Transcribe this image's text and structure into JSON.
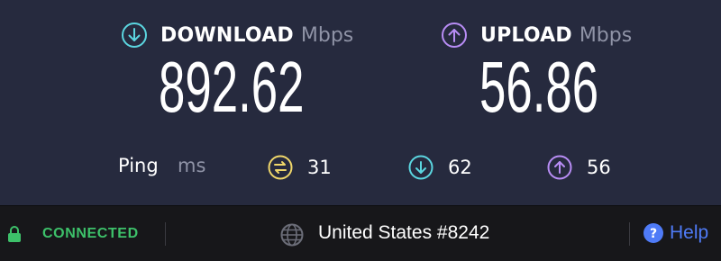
{
  "download": {
    "label": "DOWNLOAD",
    "unit": "Mbps",
    "value": "892.62",
    "icon": "arrow-down-circle-icon",
    "color": "#5bd6e0"
  },
  "upload": {
    "label": "UPLOAD",
    "unit": "Mbps",
    "value": "56.86",
    "icon": "arrow-up-circle-icon",
    "color": "#b88df5"
  },
  "ping": {
    "label": "Ping",
    "unit": "ms",
    "idle": {
      "value": "31",
      "icon": "ping-idle-icon",
      "color": "#f0d76a"
    },
    "download": {
      "value": "62",
      "icon": "arrow-down-circle-icon",
      "color": "#5bd6e0"
    },
    "upload": {
      "value": "56",
      "icon": "arrow-up-circle-icon",
      "color": "#b88df5"
    }
  },
  "status_bar": {
    "status": "CONNECTED",
    "status_color": "#3dc16a",
    "lock_icon": "lock-icon",
    "globe_icon": "globe-icon",
    "server": "United States #8242",
    "help_label": "Help",
    "help_icon": "help-circle-icon",
    "help_color": "#4f7bf7"
  }
}
